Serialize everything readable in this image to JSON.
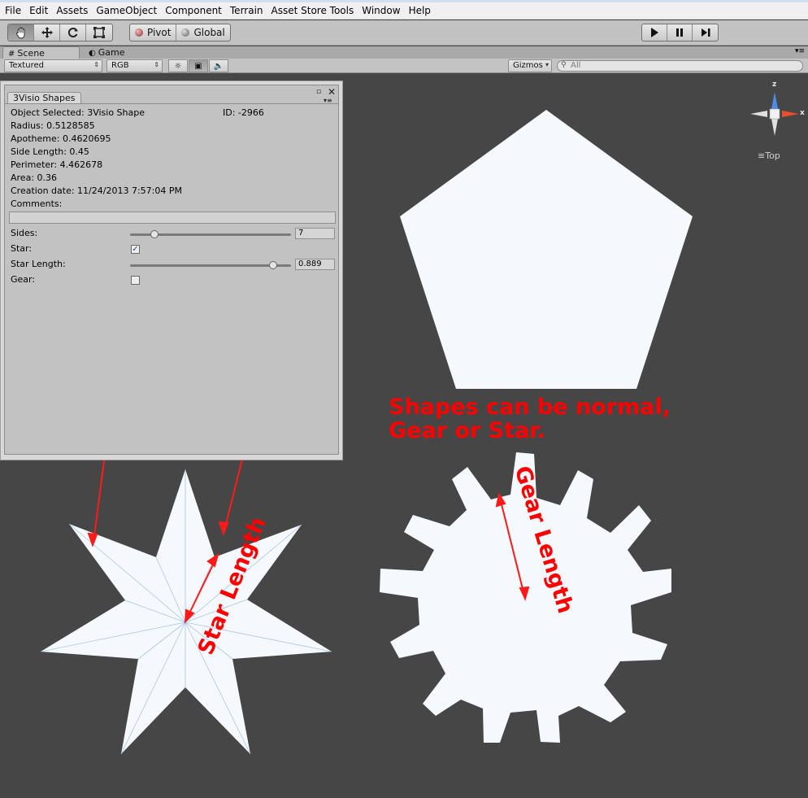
{
  "menubar": {
    "items": [
      "File",
      "Edit",
      "Assets",
      "GameObject",
      "Component",
      "Terrain",
      "Asset Store Tools",
      "Window",
      "Help"
    ]
  },
  "toolbar": {
    "tools": [
      "hand-icon",
      "move-icon",
      "rotate-icon",
      "scale-icon"
    ],
    "pivot_label": "Pivot",
    "global_label": "Global",
    "play_icons": [
      "play-icon",
      "pause-icon",
      "step-icon"
    ]
  },
  "tabs": {
    "scene": "Scene",
    "game": "Game"
  },
  "scenebar": {
    "render_mode": "Textured",
    "color_mode": "RGB",
    "gizmos_label": "Gizmos",
    "search_placeholder": "All"
  },
  "gizmo": {
    "axis_label": "z",
    "x_label": "x",
    "view_label": "Top"
  },
  "inspector": {
    "tab_title": "3Visio Shapes",
    "object_selected": "Object Selected: 3Visio Shape",
    "id": "ID: -2966",
    "radius": "Radius: 0.5128585",
    "apotheme": "Apotheme: 0.4620695",
    "side_length": "Side Length: 0.45",
    "perimeter": "Perimeter: 4.462678",
    "area": "Area: 0.36",
    "creation_date": "Creation date: 11/24/2013 7:57:04 PM",
    "comments_label": "Comments:",
    "sides_label": "Sides:",
    "sides_value": "7",
    "sides_level": 0.15,
    "star_label": "Star:",
    "star_checked": true,
    "star_length_label": "Star Length:",
    "star_length_value": "0.889",
    "star_length_level": 0.889,
    "gear_label": "Gear:",
    "gear_checked": false
  },
  "annotations": {
    "shapes_line1": "Shapes can be normal,",
    "shapes_line2": "Gear or Star.",
    "star_length": "Star Length",
    "gear_length": "Gear Length",
    "color": "#ff0000"
  },
  "colors": {
    "scene_bg": "#464646",
    "shape_fill": "#f5f9fd"
  }
}
